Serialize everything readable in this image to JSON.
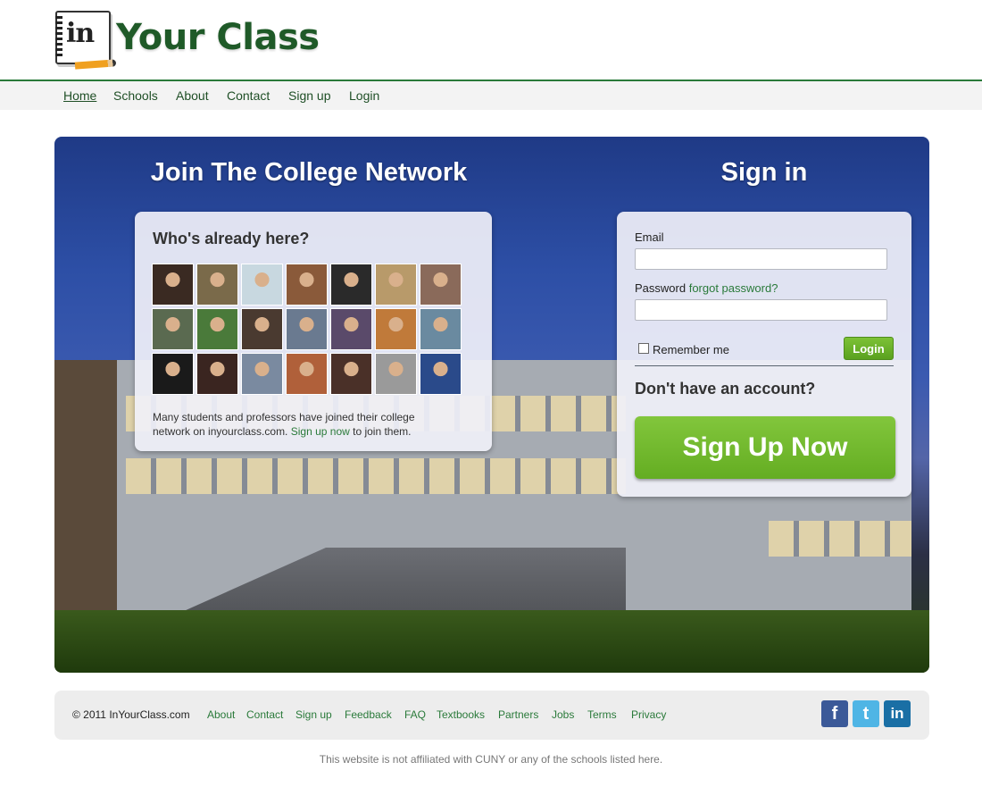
{
  "brand": {
    "logo_mark": "in",
    "logo_text": "Your Class"
  },
  "nav": {
    "items": [
      {
        "label": "Home",
        "active": true
      },
      {
        "label": "Schools"
      },
      {
        "label": "About"
      },
      {
        "label": "Contact"
      },
      {
        "label": "Sign up"
      },
      {
        "label": "Login"
      }
    ]
  },
  "hero": {
    "join_heading": "Join The College Network",
    "signin_heading": "Sign in",
    "who": {
      "title": "Who's already here?",
      "text_before": "Many students and professors have joined their college network on inyourclass.com. ",
      "link": "Sign up now",
      "text_after": " to join them.",
      "avatar_colors": [
        "#3a2a22",
        "#7a6a4a",
        "#c8d8e0",
        "#8a5a3a",
        "#2a2a2a",
        "#b89a6a",
        "#8a6a5a",
        "#5a6a50",
        "#4a7a3a",
        "#4a3a30",
        "#6a7a90",
        "#5a4a6a",
        "#c07a3a",
        "#6a8aa0",
        "#1a1a1a",
        "#3a2520",
        "#7a8aa0",
        "#b0603a",
        "#4a3028",
        "#9a9a9a",
        "#2a4a8a"
      ]
    },
    "signin": {
      "email_label": "Email",
      "password_label": "Password",
      "forgot_link": "forgot password?",
      "remember_label": "Remember me",
      "login_button": "Login",
      "no_account": "Don't have an account?",
      "signup_button": "Sign Up Now"
    }
  },
  "footer": {
    "copyright": "© 2011 InYourClass.com",
    "links": [
      "About",
      "Contact",
      "Sign up",
      "Feedback",
      "FAQ",
      "Textbooks",
      "Partners",
      "Jobs",
      "Terms",
      "Privacy"
    ],
    "social": [
      {
        "icon": "facebook-icon",
        "glyph": "f",
        "color": "#3b5998"
      },
      {
        "icon": "twitter-icon",
        "glyph": "t",
        "color": "#4fb5e5"
      },
      {
        "icon": "linkedin-icon",
        "glyph": "in",
        "color": "#1a6fa5"
      }
    ],
    "disclaimer": "This website is not affiliated with CUNY or any of the schools listed here."
  }
}
